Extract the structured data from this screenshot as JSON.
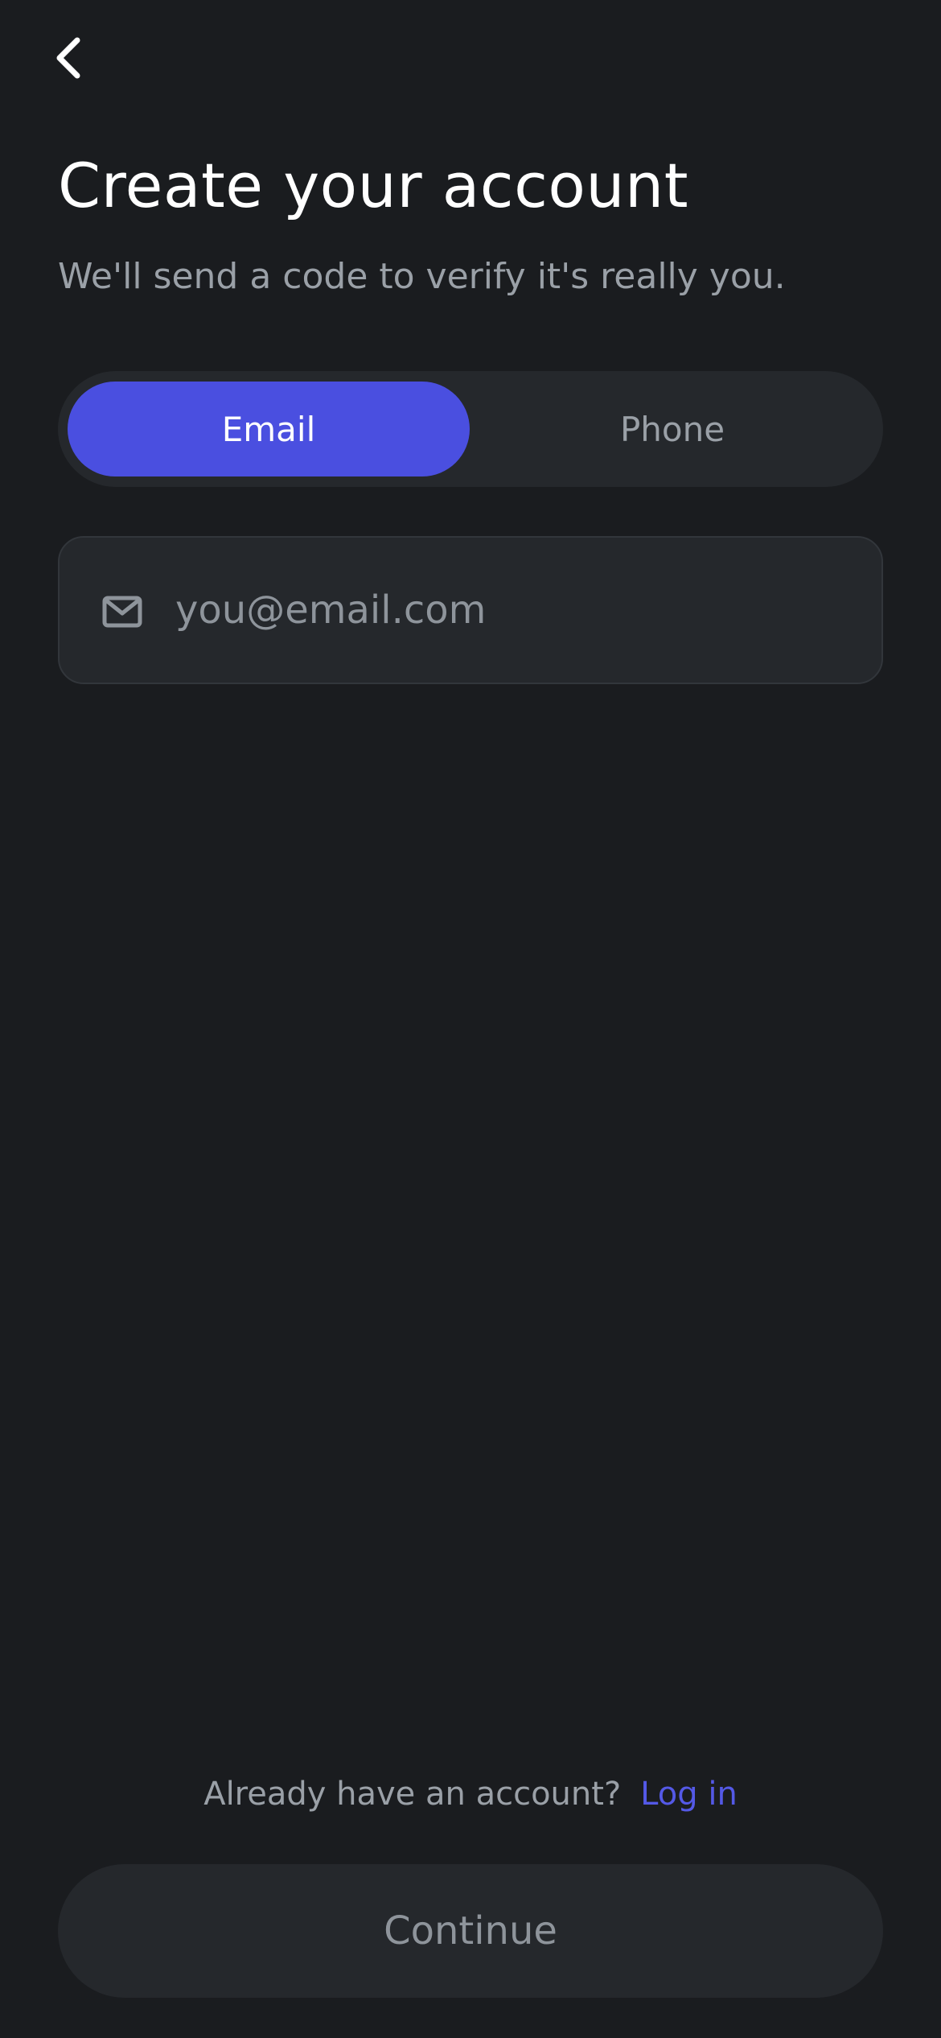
{
  "header": {
    "back_icon": "chevron-left-icon",
    "title": "Create your account",
    "subtitle": "We'll send a code to verify it's really you."
  },
  "method_toggle": {
    "options": [
      "Email",
      "Phone"
    ],
    "selected": "Email"
  },
  "email_field": {
    "icon": "mail-icon",
    "value": "",
    "placeholder": "you@email.com"
  },
  "footer": {
    "login_prompt": "Already have an account?",
    "login_link": "Log in",
    "continue_label": "Continue"
  },
  "colors": {
    "background": "#1a1c1f",
    "surface": "#25282c",
    "accent": "#4a4fe0",
    "link": "#5459e6",
    "muted_text": "#9aa0a7"
  }
}
